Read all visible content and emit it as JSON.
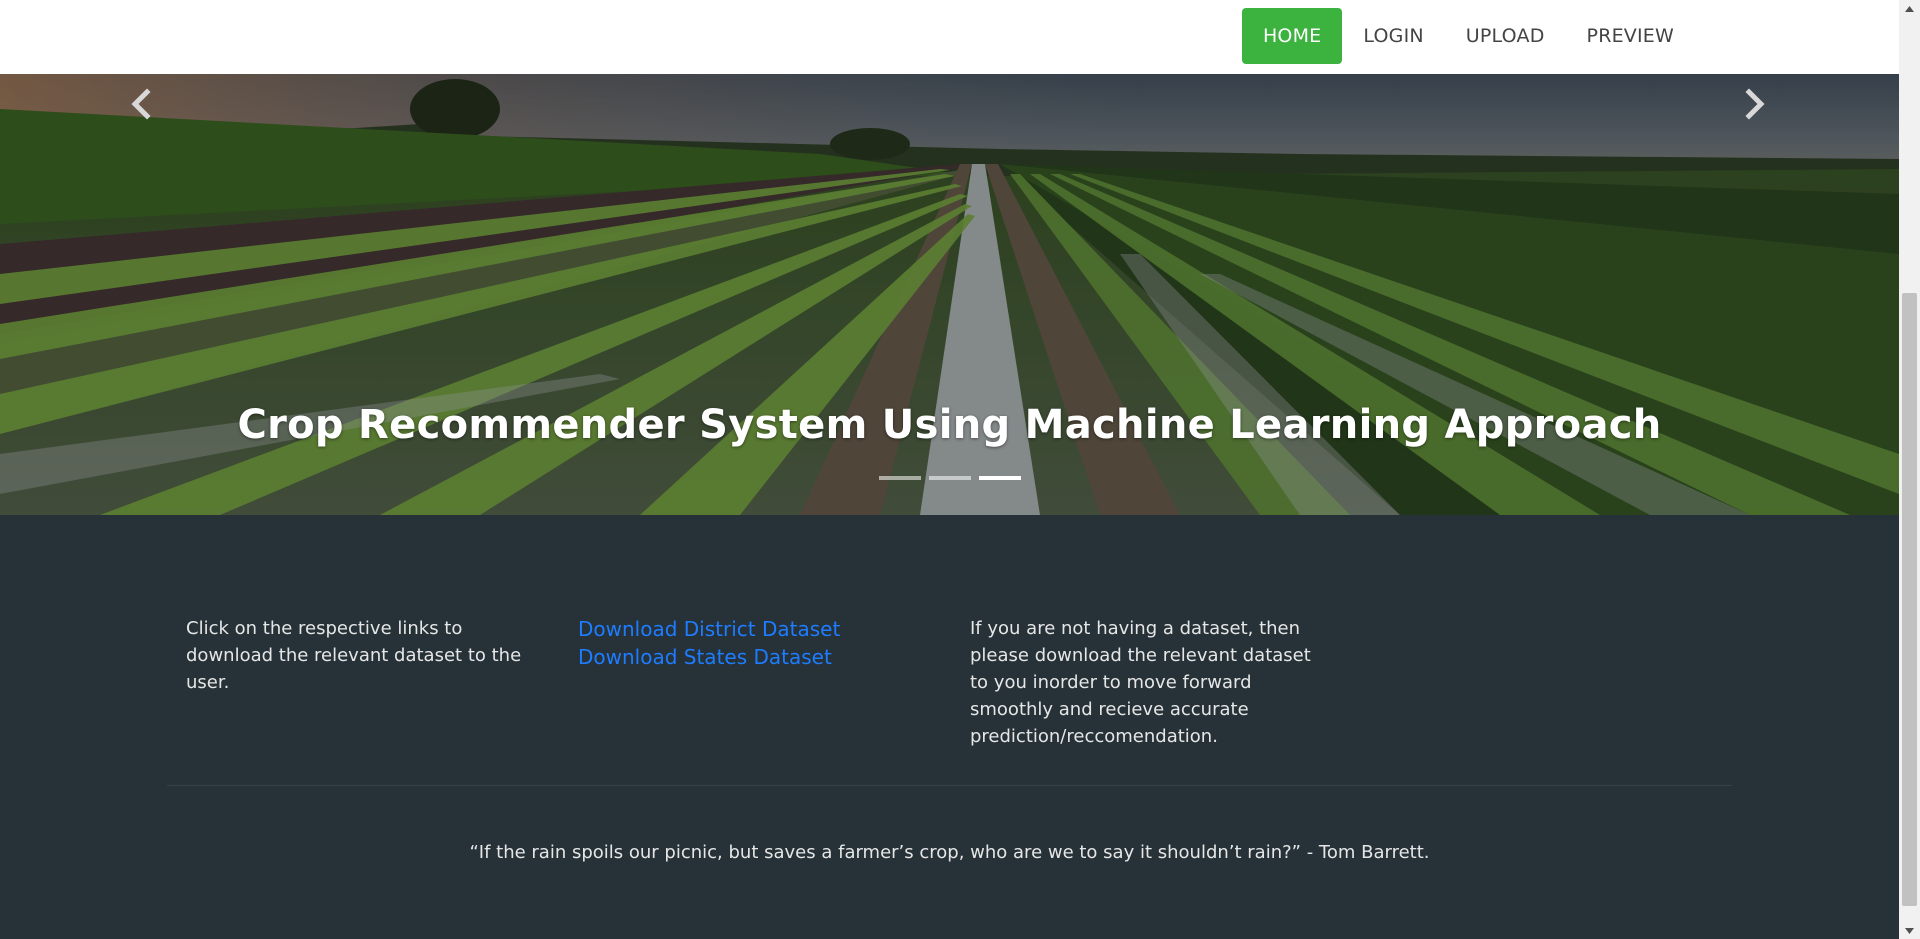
{
  "nav": {
    "items": [
      {
        "label": "HOME",
        "active": true
      },
      {
        "label": "LOGIN",
        "active": false
      },
      {
        "label": "UPLOAD",
        "active": false
      },
      {
        "label": "PREVIEW",
        "active": false
      }
    ],
    "active_color": "#3cb23f"
  },
  "hero": {
    "title": "Crop Recommender System Using Machine Learning Approach",
    "prev_icon": "chevron-left-icon",
    "next_icon": "chevron-right-icon",
    "slides": 3,
    "active_slide": 3
  },
  "info": {
    "left_text": "Click on the respective links to download the relevant dataset to the user.",
    "links": [
      {
        "label": "Download District Dataset"
      },
      {
        "label": "Download States Dataset"
      }
    ],
    "right_text": "If you are not having a dataset, then please download the relevant dataset to you inorder to move forward smoothly and recieve accurate prediction/reccomendation.",
    "quote": "“If the rain spoils our picnic, but saves a farmer’s crop, who are we to say it shouldn’t rain?” - Tom Barrett.",
    "link_color": "#1e7cff",
    "background": "#263238"
  },
  "scrollbar": {
    "up_icon": "scroll-up-arrow-icon",
    "down_icon": "scroll-down-arrow-icon"
  }
}
